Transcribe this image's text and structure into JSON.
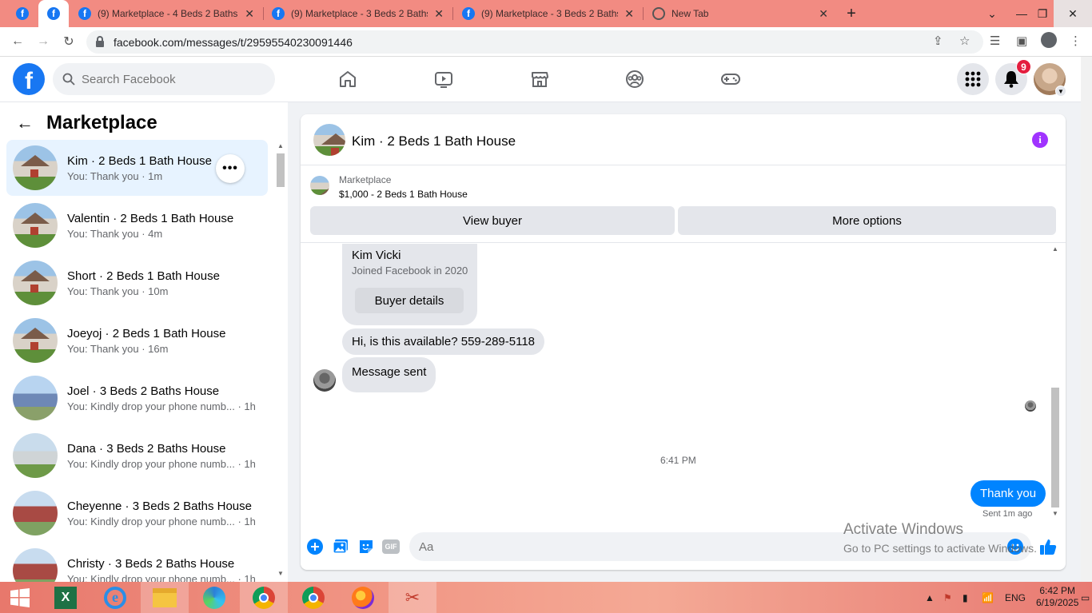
{
  "browser": {
    "tabs": [
      {
        "title": "",
        "favicon": "facebook"
      },
      {
        "title": "",
        "favicon": "facebook",
        "active": true
      },
      {
        "title": "(9) Marketplace - 4 Beds 2 Baths",
        "favicon": "facebook"
      },
      {
        "title": "(9) Marketplace - 3 Beds 2 Baths",
        "favicon": "facebook"
      },
      {
        "title": "(9) Marketplace - 3 Beds 2 Baths",
        "favicon": "facebook"
      },
      {
        "title": "New Tab",
        "favicon": "chrome"
      }
    ],
    "new_tab_label": "+",
    "url": "facebook.com/messages/t/29595540230091446",
    "tab_strip_color": "#f28b82"
  },
  "fb_header": {
    "logo": "f",
    "search_placeholder": "Search Facebook",
    "notification_count": "9",
    "brand_color": "#1877f2"
  },
  "sidebar": {
    "title": "Marketplace",
    "conversations": [
      {
        "name": "Kim · 2 Beds 1 Bath House",
        "preview": "You: Thank you · 1m",
        "thumb": "house-white",
        "active": true
      },
      {
        "name": "Valentin · 2 Beds 1 Bath House",
        "preview": "You: Thank you · 4m",
        "thumb": "house-white"
      },
      {
        "name": "Short · 2 Beds 1 Bath House",
        "preview": "You: Thank you · 10m",
        "thumb": "house-white"
      },
      {
        "name": "Joeyoj · 2 Beds 1 Bath House",
        "preview": "You: Thank you · 16m",
        "thumb": "house-white"
      },
      {
        "name": "Joel · 3 Beds 2 Baths House",
        "preview": "You: Kindly drop your phone numb... · 1h",
        "thumb": "house-blue"
      },
      {
        "name": "Dana · 3 Beds 2 Baths House",
        "preview": "You: Kindly drop your phone numb... · 1h",
        "thumb": "house-gray"
      },
      {
        "name": "Cheyenne · 3 Beds 2 Baths House",
        "preview": "You: Kindly drop your phone numb... · 1h",
        "thumb": "house-red"
      },
      {
        "name": "Christy · 3 Beds 2 Baths House",
        "preview": "You: Kindly drop your phone numb... · 1h",
        "thumb": "house-red"
      }
    ],
    "more_label": "•••"
  },
  "chat": {
    "title": "Kim · 2 Beds 1 Bath House",
    "info_label": "i",
    "marketplace_label": "Marketplace",
    "listing": "$1,000 - 2 Beds 1 Bath House",
    "view_buyer": "View buyer",
    "more_options": "More options",
    "buyer_card": {
      "name": "Kim Vicki",
      "joined": "Joined Facebook in 2020",
      "button": "Buyer details"
    },
    "messages": [
      {
        "from": "buyer",
        "text": "Hi, is this available? 559-289-5118"
      },
      {
        "from": "buyer",
        "text": "Message sent"
      }
    ],
    "timestamp": "6:41 PM",
    "my_message": "Thank you",
    "sent_status": "Sent 1m ago",
    "composer_placeholder": "Aa",
    "gif_label": "GIF",
    "accent_color": "#0084ff"
  },
  "watermark": {
    "line1": "Activate Windows",
    "line2": "Go to PC settings to activate Windows."
  },
  "taskbar": {
    "language": "ENG",
    "time": "6:42 PM",
    "date": "6/19/2025"
  }
}
